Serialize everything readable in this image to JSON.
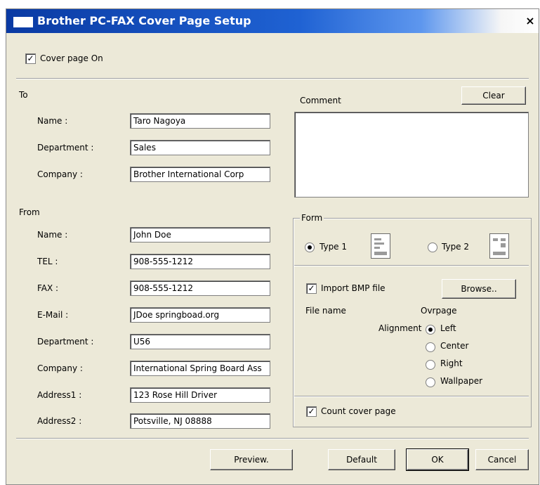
{
  "window": {
    "title": "Brother PC-FAX Cover Page Setup",
    "close_glyph": "×"
  },
  "cover_page_on": {
    "label": "Cover page On",
    "checked": true
  },
  "to": {
    "section_label": "To",
    "name": {
      "label": "Name :",
      "value": "Taro Nagoya"
    },
    "department": {
      "label": "Department :",
      "value": "Sales"
    },
    "company": {
      "label": "Company :",
      "value": "Brother International Corp"
    }
  },
  "from": {
    "section_label": "From",
    "name": {
      "label": "Name :",
      "value": "John Doe"
    },
    "tel": {
      "label": "TEL :",
      "value": "908-555-1212"
    },
    "fax": {
      "label": "FAX :",
      "value": "908-555-1212"
    },
    "email": {
      "label": "E-Mail :",
      "value": "JDoe springboad.org"
    },
    "department": {
      "label": "Department :",
      "value": "U56"
    },
    "company": {
      "label": "Company :",
      "value": "International Spring Board Ass"
    },
    "address1": {
      "label": "Address1 :",
      "value": "123 Rose Hill Driver"
    },
    "address2": {
      "label": "Address2 :",
      "value": "Potsville, NJ 08888"
    }
  },
  "comment": {
    "label": "Comment",
    "clear_label": "Clear",
    "value": ""
  },
  "form": {
    "group_label": "Form",
    "type1": {
      "label": "Type 1",
      "selected": true
    },
    "type2": {
      "label": "Type 2",
      "selected": false
    },
    "import_bmp": {
      "label": "Import BMP file",
      "checked": true
    },
    "browse_label": "Browse..",
    "file_name_label": "File name",
    "overpage_label": "Ovrpage",
    "alignment_label": "Alignment",
    "alignment_options": [
      "Left",
      "Center",
      "Right",
      "Wallpaper"
    ],
    "alignment_selected": "Left",
    "count_cover_page": {
      "label": "Count cover page",
      "checked": true
    }
  },
  "buttons": {
    "preview": "Preview.",
    "default": "Default",
    "ok": "OK",
    "cancel": "Cancel"
  },
  "colors": {
    "dialog_bg": "#ece9d8",
    "title_blue": "#0a3aa3"
  }
}
